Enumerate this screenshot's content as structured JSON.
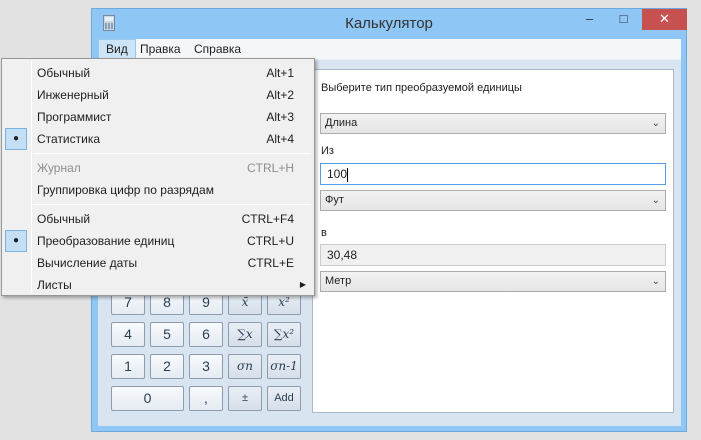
{
  "window": {
    "title": "Калькулятор",
    "minimize": "–",
    "maximize": "□",
    "close": "✕"
  },
  "menubar": [
    "Вид",
    "Правка",
    "Справка"
  ],
  "view_menu": {
    "group1": [
      {
        "label": "Обычный",
        "shortcut": "Alt+1",
        "checked": false
      },
      {
        "label": "Инженерный",
        "shortcut": "Alt+2",
        "checked": false
      },
      {
        "label": "Программист",
        "shortcut": "Alt+3",
        "checked": false
      },
      {
        "label": "Статистика",
        "shortcut": "Alt+4",
        "checked": true
      }
    ],
    "group2": [
      {
        "label": "Журнал",
        "shortcut": "CTRL+H",
        "disabled": true
      },
      {
        "label": "Группировка цифр по разрядам",
        "shortcut": ""
      }
    ],
    "group3": [
      {
        "label": "Обычный",
        "shortcut": "CTRL+F4",
        "checked": false
      },
      {
        "label": "Преобразование единиц",
        "shortcut": "CTRL+U",
        "checked": true
      },
      {
        "label": "Вычисление даты",
        "shortcut": "CTRL+E",
        "checked": false
      },
      {
        "label": "Листы",
        "shortcut": "",
        "submenu": true
      }
    ],
    "check_glyph": "●",
    "submenu_glyph": "▶"
  },
  "converter": {
    "prompt": "Выберите тип преобразуемой единицы",
    "type": "Длина",
    "from_label": "Из",
    "from_value": "100",
    "from_unit": "Фут",
    "to_label": "в",
    "to_value": "30,48",
    "to_unit": "Метр",
    "chevron": "⌄"
  },
  "keys": {
    "row1": [
      "7",
      "8",
      "9",
      "x̄",
      "x²"
    ],
    "row2": [
      "4",
      "5",
      "6",
      "∑x",
      "∑x²"
    ],
    "row3": [
      "1",
      "2",
      "3",
      "σn",
      "σn-1"
    ],
    "row4": [
      "0",
      ",",
      "±",
      "Add"
    ]
  }
}
